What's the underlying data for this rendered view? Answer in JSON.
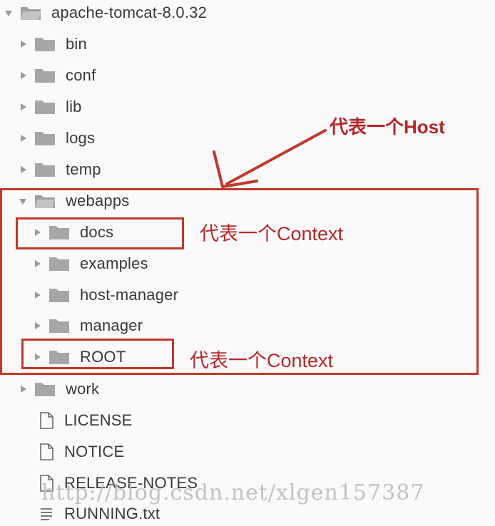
{
  "tree": {
    "root": {
      "label": "apache-tomcat-8.0.32",
      "icon": "folder-open-icon",
      "expanded": true
    },
    "children": [
      {
        "id": "bin",
        "label": "bin",
        "type": "folder",
        "icon": "folder-icon"
      },
      {
        "id": "conf",
        "label": "conf",
        "type": "folder",
        "icon": "folder-icon"
      },
      {
        "id": "lib",
        "label": "lib",
        "type": "folder",
        "icon": "folder-icon"
      },
      {
        "id": "logs",
        "label": "logs",
        "type": "folder",
        "icon": "folder-icon"
      },
      {
        "id": "temp",
        "label": "temp",
        "type": "folder",
        "icon": "folder-icon"
      },
      {
        "id": "webapps",
        "label": "webapps",
        "type": "folder",
        "icon": "folder-open-icon",
        "expanded": true,
        "children": [
          {
            "id": "docs",
            "label": "docs"
          },
          {
            "id": "examples",
            "label": "examples"
          },
          {
            "id": "host-manager",
            "label": "host-manager"
          },
          {
            "id": "manager",
            "label": "manager"
          },
          {
            "id": "root",
            "label": "ROOT"
          }
        ]
      },
      {
        "id": "work",
        "label": "work",
        "type": "folder",
        "icon": "folder-icon"
      },
      {
        "id": "license",
        "label": "LICENSE",
        "type": "file",
        "icon": "file-icon"
      },
      {
        "id": "notice",
        "label": "NOTICE",
        "type": "file",
        "icon": "file-icon"
      },
      {
        "id": "release-notes",
        "label": "RELEASE-NOTES",
        "type": "file",
        "icon": "file-icon"
      },
      {
        "id": "running",
        "label": "RUNNING.txt",
        "type": "file",
        "icon": "text-file-icon"
      }
    ]
  },
  "annotations": {
    "host": "代表一个Host",
    "context_docs": "代表一个Context",
    "context_root": "代表一个Context"
  },
  "watermark": "http://blog.csdn.net/xlgen157387",
  "colors": {
    "annotation_red": "#c0392b",
    "icon_gray": "#9b9b9b",
    "text": "#3a3a3a"
  }
}
